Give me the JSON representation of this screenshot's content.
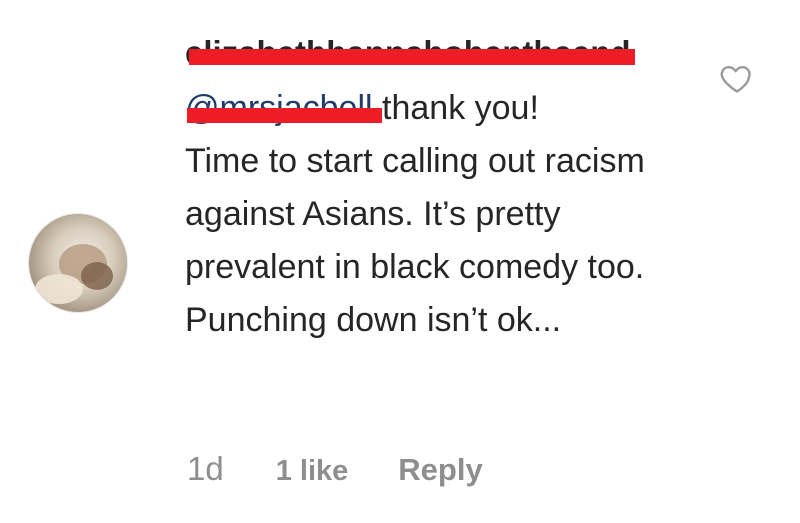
{
  "comment": {
    "username": "elizabethhannahohentheend",
    "mention": "@mrsjacbell",
    "text_line1_rest": " thank you!",
    "text_body": "Time to start calling out racism against Asians. It’s pretty prevalent in black comedy too. Punching down isn’t ok...",
    "time": "1d",
    "likes": "1 like",
    "reply_label": "Reply",
    "like_icon": "heart-outline-icon",
    "redaction_color": "#ee1c25"
  }
}
